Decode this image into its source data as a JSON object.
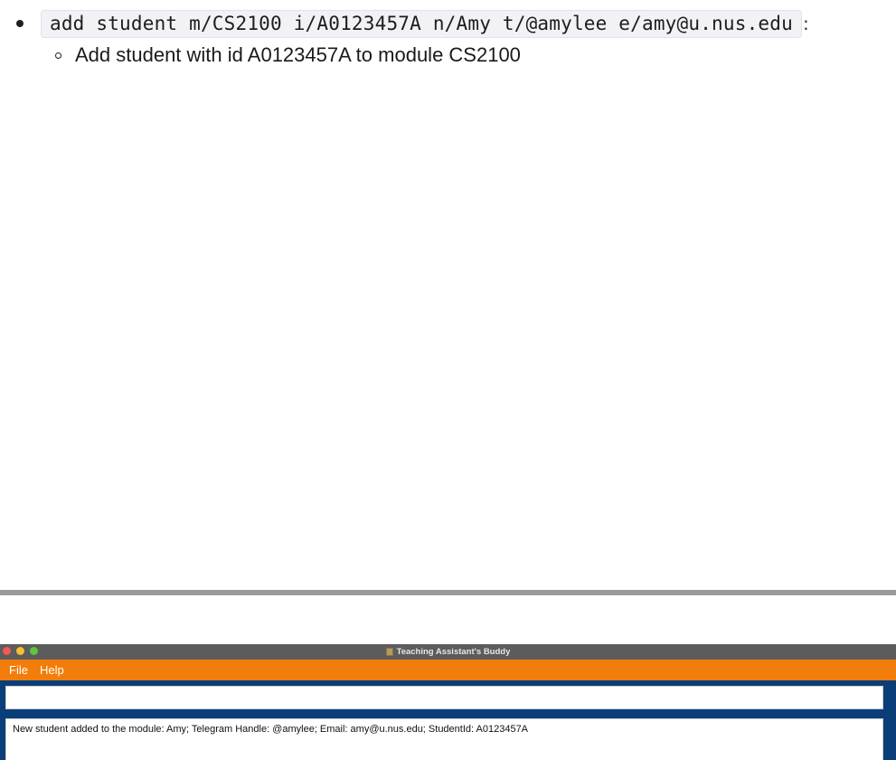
{
  "doc": {
    "command_example": "add student m/CS2100 i/A0123457A n/Amy t/@amylee e/amy@u.nus.edu",
    "command_trailing": ":",
    "sub_description": "Add student with id A0123457A to module CS2100"
  },
  "window": {
    "title": "Teaching Assistant's Buddy",
    "traffic_lights": [
      "close",
      "minimize",
      "zoom"
    ]
  },
  "menubar": {
    "items": [
      "File",
      "Help"
    ]
  },
  "command_box": {
    "value": "",
    "placeholder": ""
  },
  "result_display": {
    "text": "New student added to the module: Amy; Telegram Handle: @amylee; Email: amy@u.nus.edu; StudentId: A0123457A"
  },
  "colors": {
    "menubar": "#f27d0a",
    "window_background": "#0a3e78",
    "titlebar": "#5c5c5c",
    "divider": "#9a9a9a"
  }
}
